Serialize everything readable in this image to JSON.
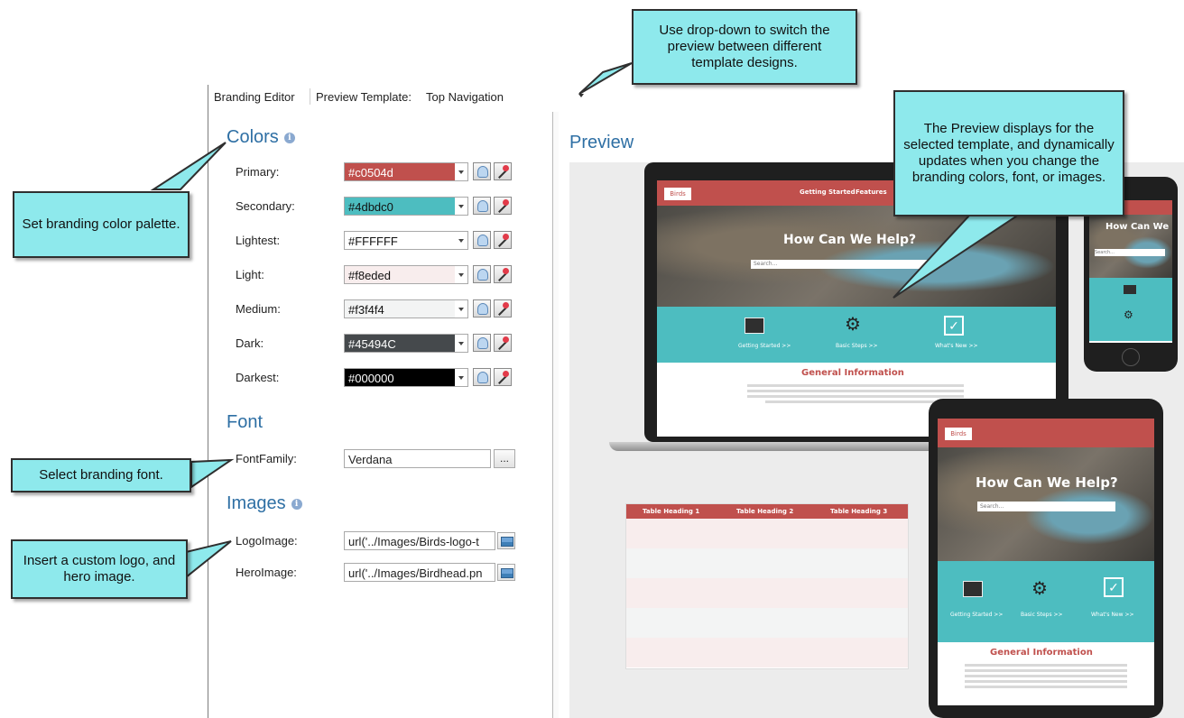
{
  "toolbar": {
    "branding_editor": "Branding Editor",
    "preview_template_label": "Preview Template:",
    "preview_template_value": "Top Navigation"
  },
  "colors": {
    "title": "Colors",
    "rows": [
      {
        "label": "Primary:",
        "value": "#c0504d",
        "swatch": "#c0504d",
        "text_color": "#ffffff"
      },
      {
        "label": "Secondary:",
        "value": "#4dbdc0",
        "swatch": "#4dbdc0",
        "text_color": "#111111"
      },
      {
        "label": "Lightest:",
        "value": "#FFFFFF",
        "swatch": "#ffffff",
        "text_color": "#111111"
      },
      {
        "label": "Light:",
        "value": "#f8eded",
        "swatch": "#f8eded",
        "text_color": "#111111"
      },
      {
        "label": "Medium:",
        "value": "#f3f4f4",
        "swatch": "#f3f4f4",
        "text_color": "#111111"
      },
      {
        "label": "Dark:",
        "value": "#45494C",
        "swatch": "#45494c",
        "text_color": "#ffffff"
      },
      {
        "label": "Darkest:",
        "value": "#000000",
        "swatch": "#000000",
        "text_color": "#ffffff"
      }
    ]
  },
  "font": {
    "title": "Font",
    "family_label": "FontFamily:",
    "family_value": "Verdana",
    "browse_label": "..."
  },
  "images": {
    "title": "Images",
    "logo_label": "LogoImage:",
    "logo_value": "url('../Images/Birds-logo-t",
    "hero_label": "HeroImage:",
    "hero_value": "url('../Images/Birdhead.pn"
  },
  "preview": {
    "title": "Preview",
    "mock": {
      "logo_text": "Birds",
      "nav_1": "Getting Started",
      "nav_2": "Features",
      "hero_heading": "How Can We Help?",
      "hero_heading_short": "How Can We",
      "search_placeholder": "Search...",
      "tile_1": "Getting Started >>",
      "tile_2": "Basic Steps >>",
      "tile_3": "What's New >>",
      "general_info": "General Information",
      "table_headings": [
        "Table Heading 1",
        "Table Heading 2",
        "Table Heading 3"
      ]
    }
  },
  "callouts": {
    "dropdown": "Use drop-down to switch the preview between different template designs.",
    "preview": "The Preview displays for the selected template, and dynamically updates when you change the branding colors, font, or images.",
    "palette": "Set branding color palette.",
    "font": "Select branding font.",
    "logo": "Insert a custom logo, and hero image."
  }
}
